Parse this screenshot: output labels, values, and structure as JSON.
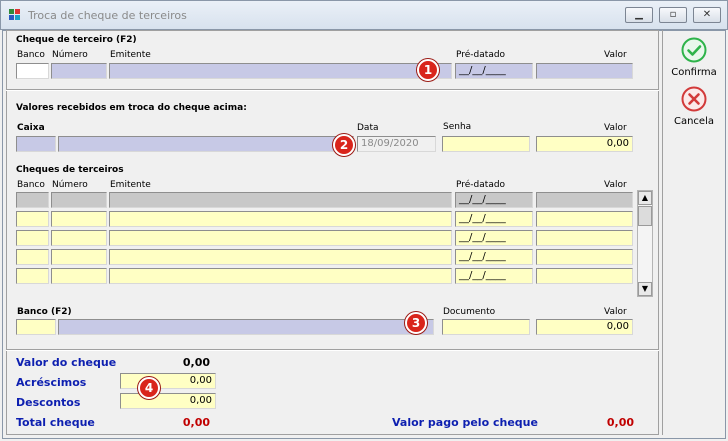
{
  "window": {
    "title": "Troca de cheque de terceiros"
  },
  "colors": {
    "accent_blue": "#0d1fb0",
    "total_red": "#c00000",
    "marker_red": "#d9251c",
    "confirm_green": "#2eb34a",
    "cancel_red": "#d23a3a"
  },
  "icons": {
    "confirm": "check-circle-icon",
    "cancel": "x-circle-icon",
    "app": "app-logo-icon"
  },
  "cheque": {
    "heading": "Cheque de terceiro (F2)",
    "col_banco": "Banco",
    "col_numero": "Número",
    "col_emitente": "Emitente",
    "col_predatado": "Pré-datado",
    "col_valor": "Valor",
    "banco": "",
    "numero": "",
    "emitente": "",
    "predatado": "__/__/____",
    "valor": ""
  },
  "recebidos": {
    "heading": "Valores recebidos em troca do cheque acima:",
    "lbl_caixa": "Caixa",
    "lbl_data": "Data",
    "lbl_senha": "Senha",
    "lbl_valor": "Valor",
    "caixa_code": "",
    "caixa_name": "",
    "data": "18/09/2020",
    "senha": "",
    "valor": "0,00"
  },
  "cheques_terceiros": {
    "heading": "Cheques de terceiros",
    "col_banco": "Banco",
    "col_numero": "Número",
    "col_emitente": "Emitente",
    "col_predatado": "Pré-datado",
    "col_valor": "Valor",
    "rows": [
      {
        "banco": "",
        "numero": "",
        "emitente": "",
        "predatado": "__/__/____",
        "valor": ""
      },
      {
        "banco": "",
        "numero": "",
        "emitente": "",
        "predatado": "__/__/____",
        "valor": ""
      },
      {
        "banco": "",
        "numero": "",
        "emitente": "",
        "predatado": "__/__/____",
        "valor": ""
      },
      {
        "banco": "",
        "numero": "",
        "emitente": "",
        "predatado": "__/__/____",
        "valor": ""
      },
      {
        "banco": "",
        "numero": "",
        "emitente": "",
        "predatado": "__/__/____",
        "valor": ""
      }
    ]
  },
  "banco": {
    "lbl_banco": "Banco (F2)",
    "lbl_documento": "Documento",
    "lbl_valor": "Valor",
    "code": "",
    "name": "",
    "documento": "",
    "valor": "0,00"
  },
  "totais": {
    "lbl_valor_cheque": "Valor do cheque",
    "valor_cheque": "0,00",
    "lbl_acrescimos": "Acréscimos",
    "acrescimos": "0,00",
    "lbl_descontos": "Descontos",
    "descontos": "0,00",
    "lbl_total": "Total cheque",
    "total": "0,00",
    "lbl_valor_pago": "Valor pago pelo cheque",
    "valor_pago": "0,00"
  },
  "markers": {
    "m1": "1",
    "m2": "2",
    "m3": "3",
    "m4": "4"
  },
  "actions": {
    "confirm": "Confirma",
    "cancel": "Cancela"
  }
}
